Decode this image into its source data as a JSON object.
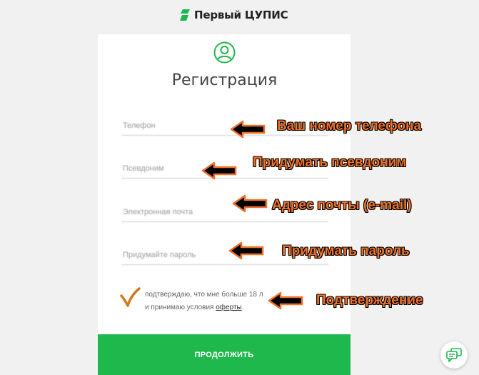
{
  "brand": {
    "name": "Первый ЦУПИС"
  },
  "form": {
    "title": "Регистрация",
    "fields": {
      "phone": {
        "placeholder": "Телефон",
        "value": ""
      },
      "nickname": {
        "placeholder": "Псевдоним",
        "value": ""
      },
      "email": {
        "placeholder": "Электронная почта",
        "value": ""
      },
      "password": {
        "placeholder": "Придумайте пароль",
        "value": ""
      }
    },
    "consent": {
      "checked": true,
      "line1": "подтверждаю, что мне больше 18 л",
      "line2_prefix": "и принимаю условия",
      "offer_link": "оферты",
      "line2_suffix": "."
    },
    "submit_label": "ПРОДОЛЖИТЬ"
  },
  "annotations": {
    "phone": "Ваш номер телефона",
    "nickname": "Придумать псевдоним",
    "email": "Адрес почты (e-mail)",
    "password": "Придумать пароль",
    "consent": "Подтверждение"
  },
  "colors": {
    "accent": "#1fb84c",
    "annotation": "#f07028"
  },
  "icons": {
    "logo": "brand-logo-icon",
    "user": "user-circle-icon",
    "chat": "chat-icon",
    "arrow": "arrow-left-icon",
    "check": "checkmark-icon"
  }
}
